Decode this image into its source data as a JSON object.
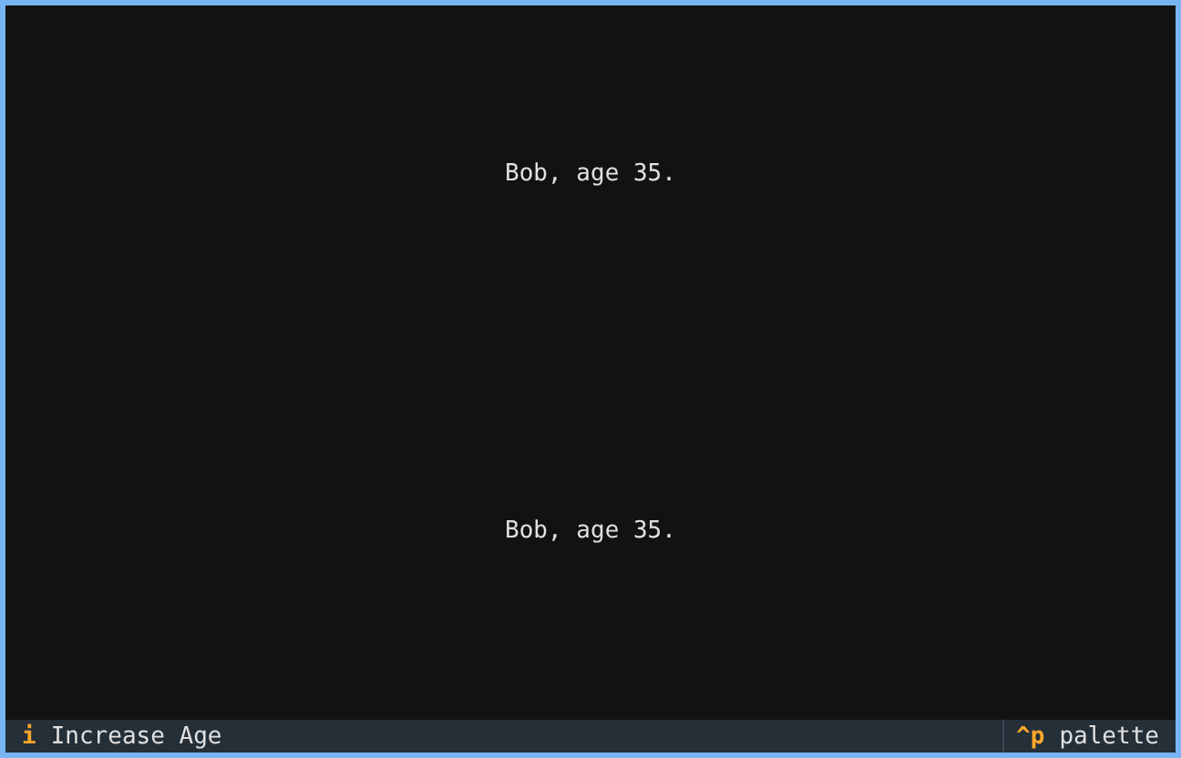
{
  "panels": [
    {
      "text": "Bob, age 35."
    },
    {
      "text": "Bob, age 35."
    }
  ],
  "footer": {
    "bindings": [
      {
        "key": "i",
        "description": "Increase Age"
      }
    ],
    "palette": {
      "key": "^p",
      "description": "palette"
    }
  }
}
